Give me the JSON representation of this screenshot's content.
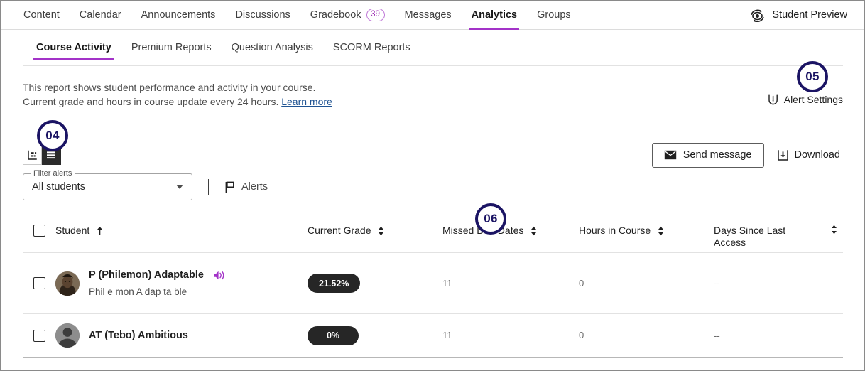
{
  "topnav": {
    "items": [
      {
        "label": "Content",
        "active": false
      },
      {
        "label": "Calendar",
        "active": false
      },
      {
        "label": "Announcements",
        "active": false
      },
      {
        "label": "Discussions",
        "active": false
      },
      {
        "label": "Gradebook",
        "active": false,
        "badge": "39"
      },
      {
        "label": "Messages",
        "active": false
      },
      {
        "label": "Analytics",
        "active": true
      },
      {
        "label": "Groups",
        "active": false
      }
    ],
    "student_preview_label": "Student Preview"
  },
  "subtabs": [
    {
      "label": "Course Activity",
      "active": true
    },
    {
      "label": "Premium Reports",
      "active": false
    },
    {
      "label": "Question Analysis",
      "active": false
    },
    {
      "label": "SCORM Reports",
      "active": false
    }
  ],
  "description": {
    "line1": "This report shows student performance and activity in your course.",
    "line2": "Current grade and hours in course update every 24 hours.",
    "link": "Learn more"
  },
  "alert_settings": {
    "label": "Alert Settings"
  },
  "toolbar": {
    "view_chart_title": "Chart view",
    "view_list_title": "List view",
    "send_message_label": "Send message",
    "download_label": "Download"
  },
  "filter": {
    "legend": "Filter alerts",
    "value": "All students",
    "options": [
      "All students"
    ],
    "alerts_label": "Alerts"
  },
  "table": {
    "columns": [
      {
        "key": "student",
        "label": "Student",
        "sort": "asc"
      },
      {
        "key": "grade",
        "label": "Current Grade",
        "sort": "none"
      },
      {
        "key": "missed",
        "label": "Missed Due Dates",
        "sort": "none"
      },
      {
        "key": "hours",
        "label": "Hours in Course",
        "sort": "none"
      },
      {
        "key": "days",
        "label": "Days Since Last Access",
        "sort": "none"
      }
    ],
    "rows": [
      {
        "name": "P (Philemon) Adaptable",
        "pronunciation": "Phil e mon A dap ta ble",
        "has_audio": true,
        "grade": "21.52%",
        "missed": "11",
        "hours": "0",
        "days": "--"
      },
      {
        "name": "AT (Tebo) Ambitious",
        "pronunciation": "",
        "has_audio": false,
        "grade": "0%",
        "missed": "11",
        "hours": "0",
        "days": "--"
      }
    ]
  },
  "steps": [
    {
      "id": "04",
      "label": "04"
    },
    {
      "id": "05",
      "label": "05"
    },
    {
      "id": "06",
      "label": "06"
    }
  ],
  "colors": {
    "accent_purple": "#a333c8",
    "badge_purple": "#9b27b0",
    "step_navy": "#1b1464",
    "pill_dark": "#262626",
    "link_blue": "#205493"
  }
}
